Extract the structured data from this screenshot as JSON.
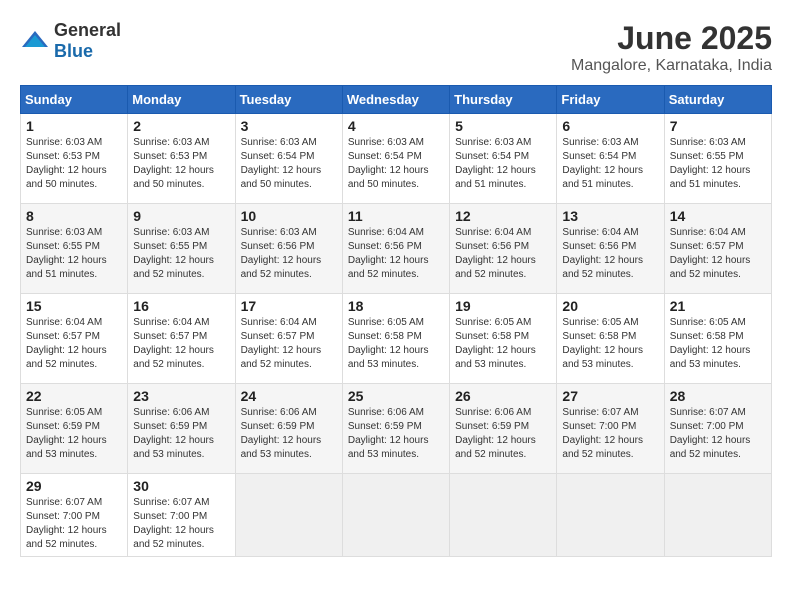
{
  "logo": {
    "general": "General",
    "blue": "Blue"
  },
  "title": {
    "month_year": "June 2025",
    "location": "Mangalore, Karnataka, India"
  },
  "calendar": {
    "headers": [
      "Sunday",
      "Monday",
      "Tuesday",
      "Wednesday",
      "Thursday",
      "Friday",
      "Saturday"
    ],
    "weeks": [
      [
        {
          "day": "1",
          "sunrise": "6:03 AM",
          "sunset": "6:53 PM",
          "daylight": "12 hours and 50 minutes."
        },
        {
          "day": "2",
          "sunrise": "6:03 AM",
          "sunset": "6:53 PM",
          "daylight": "12 hours and 50 minutes."
        },
        {
          "day": "3",
          "sunrise": "6:03 AM",
          "sunset": "6:54 PM",
          "daylight": "12 hours and 50 minutes."
        },
        {
          "day": "4",
          "sunrise": "6:03 AM",
          "sunset": "6:54 PM",
          "daylight": "12 hours and 50 minutes."
        },
        {
          "day": "5",
          "sunrise": "6:03 AM",
          "sunset": "6:54 PM",
          "daylight": "12 hours and 51 minutes."
        },
        {
          "day": "6",
          "sunrise": "6:03 AM",
          "sunset": "6:54 PM",
          "daylight": "12 hours and 51 minutes."
        },
        {
          "day": "7",
          "sunrise": "6:03 AM",
          "sunset": "6:55 PM",
          "daylight": "12 hours and 51 minutes."
        }
      ],
      [
        {
          "day": "8",
          "sunrise": "6:03 AM",
          "sunset": "6:55 PM",
          "daylight": "12 hours and 51 minutes."
        },
        {
          "day": "9",
          "sunrise": "6:03 AM",
          "sunset": "6:55 PM",
          "daylight": "12 hours and 52 minutes."
        },
        {
          "day": "10",
          "sunrise": "6:03 AM",
          "sunset": "6:56 PM",
          "daylight": "12 hours and 52 minutes."
        },
        {
          "day": "11",
          "sunrise": "6:04 AM",
          "sunset": "6:56 PM",
          "daylight": "12 hours and 52 minutes."
        },
        {
          "day": "12",
          "sunrise": "6:04 AM",
          "sunset": "6:56 PM",
          "daylight": "12 hours and 52 minutes."
        },
        {
          "day": "13",
          "sunrise": "6:04 AM",
          "sunset": "6:56 PM",
          "daylight": "12 hours and 52 minutes."
        },
        {
          "day": "14",
          "sunrise": "6:04 AM",
          "sunset": "6:57 PM",
          "daylight": "12 hours and 52 minutes."
        }
      ],
      [
        {
          "day": "15",
          "sunrise": "6:04 AM",
          "sunset": "6:57 PM",
          "daylight": "12 hours and 52 minutes."
        },
        {
          "day": "16",
          "sunrise": "6:04 AM",
          "sunset": "6:57 PM",
          "daylight": "12 hours and 52 minutes."
        },
        {
          "day": "17",
          "sunrise": "6:04 AM",
          "sunset": "6:57 PM",
          "daylight": "12 hours and 52 minutes."
        },
        {
          "day": "18",
          "sunrise": "6:05 AM",
          "sunset": "6:58 PM",
          "daylight": "12 hours and 53 minutes."
        },
        {
          "day": "19",
          "sunrise": "6:05 AM",
          "sunset": "6:58 PM",
          "daylight": "12 hours and 53 minutes."
        },
        {
          "day": "20",
          "sunrise": "6:05 AM",
          "sunset": "6:58 PM",
          "daylight": "12 hours and 53 minutes."
        },
        {
          "day": "21",
          "sunrise": "6:05 AM",
          "sunset": "6:58 PM",
          "daylight": "12 hours and 53 minutes."
        }
      ],
      [
        {
          "day": "22",
          "sunrise": "6:05 AM",
          "sunset": "6:59 PM",
          "daylight": "12 hours and 53 minutes."
        },
        {
          "day": "23",
          "sunrise": "6:06 AM",
          "sunset": "6:59 PM",
          "daylight": "12 hours and 53 minutes."
        },
        {
          "day": "24",
          "sunrise": "6:06 AM",
          "sunset": "6:59 PM",
          "daylight": "12 hours and 53 minutes."
        },
        {
          "day": "25",
          "sunrise": "6:06 AM",
          "sunset": "6:59 PM",
          "daylight": "12 hours and 53 minutes."
        },
        {
          "day": "26",
          "sunrise": "6:06 AM",
          "sunset": "6:59 PM",
          "daylight": "12 hours and 52 minutes."
        },
        {
          "day": "27",
          "sunrise": "6:07 AM",
          "sunset": "7:00 PM",
          "daylight": "12 hours and 52 minutes."
        },
        {
          "day": "28",
          "sunrise": "6:07 AM",
          "sunset": "7:00 PM",
          "daylight": "12 hours and 52 minutes."
        }
      ],
      [
        {
          "day": "29",
          "sunrise": "6:07 AM",
          "sunset": "7:00 PM",
          "daylight": "12 hours and 52 minutes."
        },
        {
          "day": "30",
          "sunrise": "6:07 AM",
          "sunset": "7:00 PM",
          "daylight": "12 hours and 52 minutes."
        },
        null,
        null,
        null,
        null,
        null
      ]
    ]
  }
}
